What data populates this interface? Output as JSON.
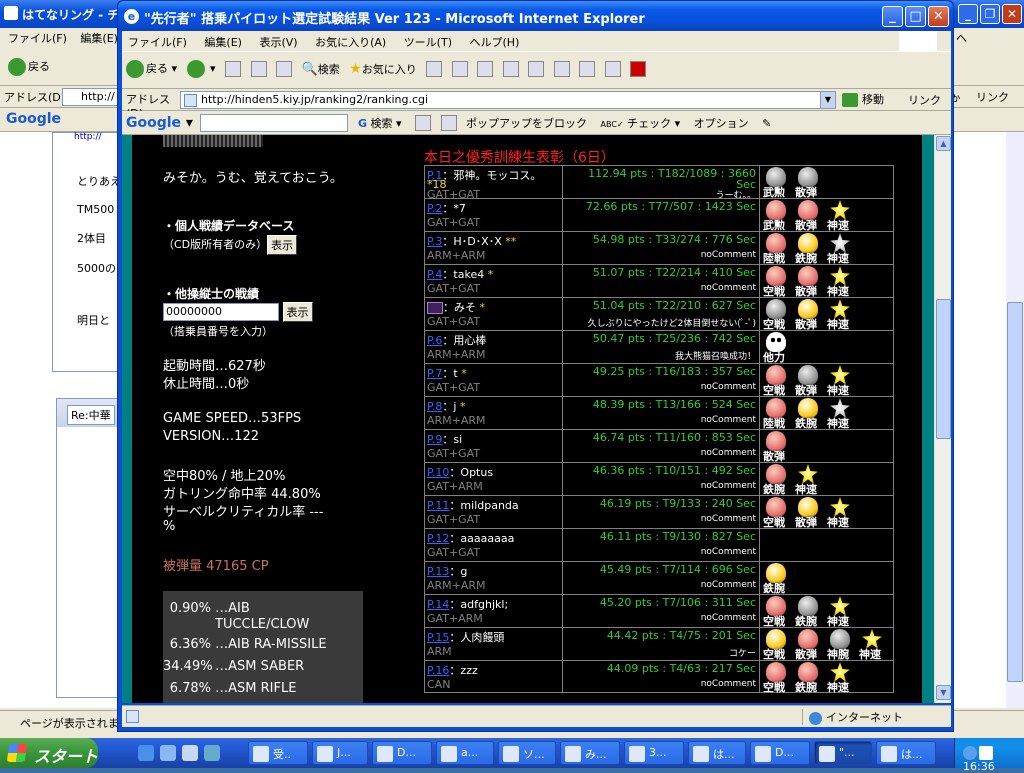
{
  "background_window": {
    "title": "はてなリング - チー",
    "menu": [
      "ファイル(F)",
      "編集(E)"
    ],
    "back_label": "戻る",
    "address_label": "アドレス(D)",
    "address_value": "http://",
    "google_label": "Google",
    "left_panel_lines": [
      "とりあえ",
      "TM500",
      "2体目",
      "5000の",
      "明日と"
    ],
    "red_link": "http://",
    "comment_title": "Re:中華",
    "status_text": "ページが表示されま",
    "right_menu_tail": "ヘ",
    "right_go": "ゕ",
    "right_links": "リンク"
  },
  "window": {
    "title": "\"先行者\" 搭乗パイロット選定試験結果 Ver 123 - Microsoft Internet Explorer",
    "menu": [
      "ファイル(F)",
      "編集(E)",
      "表示(V)",
      "お気に入り(A)",
      "ツール(T)",
      "ヘルプ(H)"
    ],
    "toolbar": {
      "back": "戻る",
      "search": "検索",
      "favorites": "お気に入り"
    },
    "address_label": "アドレス(D)",
    "url": "http://hinden5.kiy.jp/ranking2/ranking.cgi",
    "go_label": "移動",
    "links_label": "リンク",
    "google": {
      "label": "Google",
      "search": "検索",
      "popup": "ポップアップをブロック",
      "check": "チェック",
      "options": "オプション"
    },
    "status_zone": "インターネット"
  },
  "left": {
    "intro": "みそか。うむ、覚えておこう。",
    "db_heading": "・個人戦績データベース",
    "db_note": "（CD版所有者のみ）",
    "show_button": "表示",
    "other_heading": "・他操縦士の戦績",
    "other_input": "00000000",
    "other_button": "表示",
    "other_note": "（搭乗員番号を入力）",
    "uptime": "起動時間…627秒",
    "rest": "休止時間…0秒",
    "game_speed": "GAME SPEED…53FPS",
    "version": "VERSION…122",
    "air_ground": "空中80% / 地上20%",
    "gatling": "ガトリング命中率 44.80%",
    "saber": "サーベルクリティカル率 ---",
    "saber_pct": "%",
    "damage": "被弾量 47165 CP",
    "weapons": [
      {
        "pct": "0.90%",
        "name": "…AIB",
        "name2": "TUCCLE/CLOW"
      },
      {
        "pct": "6.36%",
        "name": "…AIB RA-MISSILE"
      },
      {
        "pct": "34.49%",
        "name": "…ASM SABER"
      },
      {
        "pct": "6.78%",
        "name": "…ASM RIFLE"
      }
    ]
  },
  "ranking": {
    "title": "本日之優秀訓練生表彰（6日）",
    "rows": [
      {
        "p": "P.1",
        "name": "：邪神。モッコス。",
        "star": "",
        "extra": "*18",
        "type": "GAT+GAT",
        "score": "112.94 pts : T182/1089 : 3660",
        "score2": "Sec",
        "comment": "うーむ。。",
        "badges": [
          [
            "武",
            "gray"
          ],
          [
            "勲",
            "gray"
          ],
          [
            "散",
            "gray"
          ],
          [
            "弾",
            "gray"
          ]
        ]
      },
      {
        "p": "P.2",
        "name": "：*7",
        "star": "",
        "type": "GAT+GAT",
        "score": "72.66 pts : T77/507 : 1423 Sec",
        "comment": "",
        "badges": [
          [
            "武",
            "red"
          ],
          [
            "勲",
            "red"
          ],
          [
            "散",
            "red"
          ],
          [
            "弾",
            "red"
          ],
          [
            "神",
            "ystar"
          ],
          [
            "速",
            "ystar"
          ]
        ]
      },
      {
        "p": "P.3",
        "name": "：H･D･X･X",
        "star": "**",
        "type": "ARM+ARM",
        "score": "54.98 pts : T33/274 : 776 Sec",
        "comment": "noComment",
        "badges": [
          [
            "陸",
            "red"
          ],
          [
            "戦",
            "red"
          ],
          [
            "鉄",
            "gold"
          ],
          [
            "腕",
            "gold"
          ],
          [
            "神",
            "gstar"
          ],
          [
            "速",
            "gstar"
          ]
        ]
      },
      {
        "p": "P.4",
        "name": "：take4",
        "star": "*",
        "type": "GAT+GAT",
        "score": "51.07 pts : T22/214 : 410 Sec",
        "comment": "noComment",
        "badges": [
          [
            "空",
            "red"
          ],
          [
            "戦",
            "red"
          ],
          [
            "散",
            "red"
          ],
          [
            "弾",
            "red"
          ],
          [
            "神",
            "ystar"
          ],
          [
            "速",
            "ystar"
          ]
        ]
      },
      {
        "p": "",
        "name": "：みそ",
        "star": "*",
        "type": "GAT+GAT",
        "score": "51.04 pts : T22/210 : 627 Sec",
        "comment": "久しぶりにやったけど2体目倒せない(ﾟ-ﾟ)",
        "badges": [
          [
            "空",
            "gray"
          ],
          [
            "戦",
            "gray"
          ],
          [
            "散",
            "gold"
          ],
          [
            "弾",
            "gold"
          ],
          [
            "神",
            "ystar"
          ],
          [
            "速",
            "ystar"
          ]
        ]
      },
      {
        "p": "P.6",
        "name": "：用心棒",
        "star": "",
        "type": "ARM+ARM",
        "score": "50.47 pts : T25/236 : 742 Sec",
        "comment": "我大熊猫召喚成功！",
        "badges": [
          [
            "他",
            "panda"
          ],
          [
            "力",
            "panda"
          ]
        ]
      },
      {
        "p": "P.7",
        "name": "：t",
        "star": "*",
        "type": "GAT+GAT",
        "score": "49.25 pts : T16/183 : 357 Sec",
        "comment": "noComment",
        "badges": [
          [
            "空",
            "red"
          ],
          [
            "戦",
            "red"
          ],
          [
            "散",
            "gray"
          ],
          [
            "弾",
            "gray"
          ],
          [
            "神",
            "ystar"
          ],
          [
            "速",
            "ystar"
          ]
        ]
      },
      {
        "p": "P.8",
        "name": "：j",
        "star": "*",
        "type": "ARM+ARM",
        "score": "48.39 pts : T13/166 : 524 Sec",
        "comment": "noComment",
        "badges": [
          [
            "陸",
            "red"
          ],
          [
            "戦",
            "red"
          ],
          [
            "鉄",
            "gold"
          ],
          [
            "腕",
            "gold"
          ],
          [
            "神",
            "gstar"
          ],
          [
            "速",
            "gstar"
          ]
        ]
      },
      {
        "p": "P.9",
        "name": "：si",
        "star": "",
        "type": "GAT+GAT",
        "score": "46.74 pts : T11/160 : 853 Sec",
        "comment": "noComment",
        "badges": [
          [
            "散",
            "red"
          ],
          [
            "弾",
            "red"
          ]
        ]
      },
      {
        "p": "P.10",
        "name": "：Optus",
        "star": "",
        "type": "GAT+ARM",
        "score": "46.36 pts : T10/151 : 492 Sec",
        "comment": "noComment",
        "badges": [
          [
            "鉄",
            "red"
          ],
          [
            "腕",
            "red"
          ],
          [
            "神",
            "ystar"
          ],
          [
            "速",
            "ystar"
          ]
        ]
      },
      {
        "p": "P.11",
        "name": "：mildpanda",
        "star": "",
        "type": "GAT+GAT",
        "score": "46.19 pts : T9/133 : 240 Sec",
        "comment": "noComment",
        "badges": [
          [
            "空",
            "red"
          ],
          [
            "戦",
            "red"
          ],
          [
            "散",
            "gold"
          ],
          [
            "弾",
            "gold"
          ],
          [
            "神",
            "ystar"
          ],
          [
            "速",
            "ystar"
          ]
        ]
      },
      {
        "p": "P.12",
        "name": "：aaaaaaaa",
        "star": "",
        "type": "GAT+GAT",
        "score": "46.11 pts : T9/130 : 827 Sec",
        "comment": "noComment",
        "badges": []
      },
      {
        "p": "P.13",
        "name": "：g",
        "star": "",
        "type": "ARM+ARM",
        "score": "45.49 pts : T7/114 : 696 Sec",
        "comment": "noComment",
        "badges": [
          [
            "鉄",
            "gold"
          ],
          [
            "腕",
            "gold"
          ]
        ]
      },
      {
        "p": "P.14",
        "name": "：adfghjkl;",
        "star": "",
        "type": "GAT+ARM",
        "score": "45.20 pts : T7/106 : 311 Sec",
        "comment": "noComment",
        "badges": [
          [
            "空",
            "red"
          ],
          [
            "戦",
            "red"
          ],
          [
            "鉄",
            "gray"
          ],
          [
            "腕",
            "gray"
          ],
          [
            "神",
            "ystar"
          ],
          [
            "速",
            "ystar"
          ]
        ]
      },
      {
        "p": "P.15",
        "name": "：人肉饅頭",
        "star": "",
        "type": "ARM",
        "score": "44.42 pts : T4/75 : 201 Sec",
        "comment": "コケー",
        "badges": [
          [
            "空",
            "gold"
          ],
          [
            "戦",
            "gold"
          ],
          [
            "散",
            "red"
          ],
          [
            "弾",
            "red"
          ],
          [
            "神",
            "gray"
          ],
          [
            "腕",
            "gray"
          ],
          [
            "神",
            "ystar"
          ],
          [
            "速",
            "ystar"
          ]
        ]
      },
      {
        "p": "P.16",
        "name": "：zzz",
        "star": "",
        "type": "CAN",
        "score": "44.09 pts : T4/63 : 217 Sec",
        "comment": "noComment",
        "badges": [
          [
            "空",
            "red"
          ],
          [
            "戦",
            "red"
          ],
          [
            "鉄",
            "red"
          ],
          [
            "腕",
            "red"
          ],
          [
            "神",
            "ystar"
          ],
          [
            "速",
            "ystar"
          ]
        ]
      }
    ]
  },
  "taskbar": {
    "start": "スタート",
    "tasks": [
      "受..",
      "J...",
      "D...",
      "a...",
      "ソ...",
      "み...",
      "3...",
      "は...",
      "D...",
      "\"...",
      "は..."
    ],
    "time": "16:36"
  }
}
